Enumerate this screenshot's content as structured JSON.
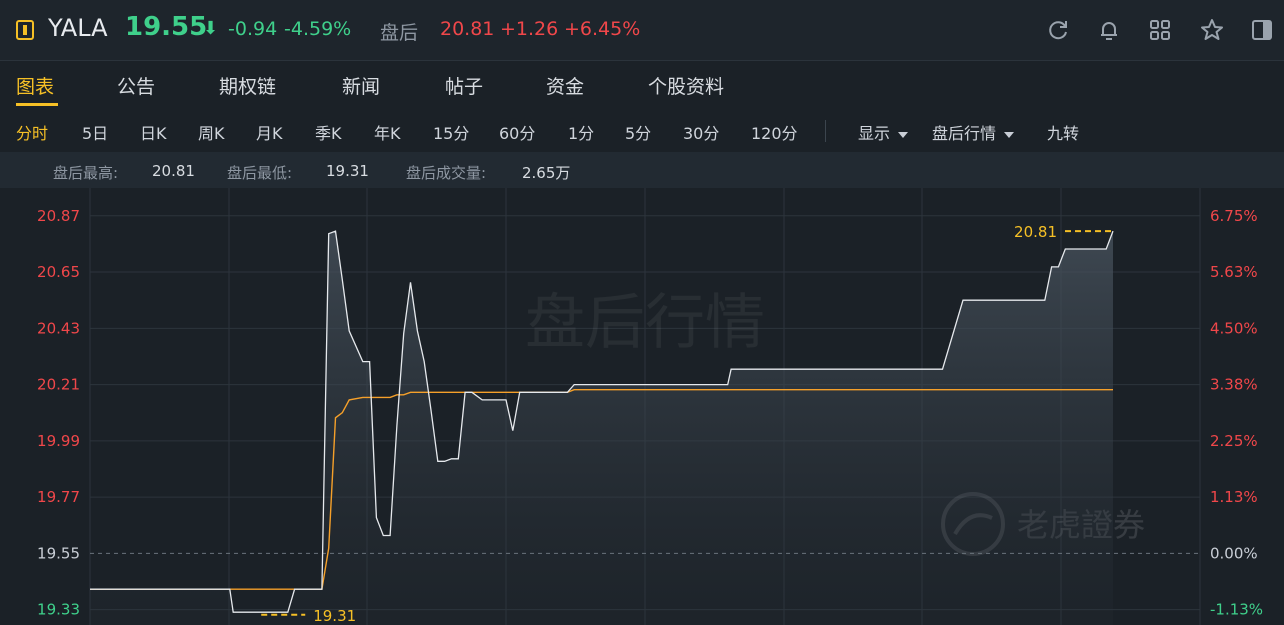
{
  "header": {
    "ticker": "YALA",
    "price": "19.55",
    "change": "-0.94",
    "change_pct": "-4.59%",
    "after_hours_label": "盘后",
    "after_hours_price": "20.81",
    "after_hours_change": "+1.26",
    "after_hours_change_pct": "+6.45%",
    "tool_icons": [
      "refresh-icon",
      "bell-icon",
      "grid-icon",
      "star-icon",
      "sidebar-toggle-icon"
    ]
  },
  "tabs": [
    "图表",
    "公告",
    "期权链",
    "新闻",
    "帖子",
    "资金",
    "个股资料"
  ],
  "periods": [
    "分时",
    "5日",
    "日K",
    "周K",
    "月K",
    "季K",
    "年K",
    "15分",
    "60分",
    "1分",
    "5分",
    "30分",
    "120分"
  ],
  "controls": {
    "display": "显示",
    "after_hours": "盘后行情",
    "nine_turn": "九转"
  },
  "stats": [
    {
      "label": "盘后最高:",
      "value": "20.81"
    },
    {
      "label": "盘后最低:",
      "value": "19.31"
    },
    {
      "label": "盘后成交量:",
      "value": "2.65万"
    }
  ],
  "watermark": {
    "text": "盘后行情",
    "brand": "老虎證券"
  },
  "colors": {
    "up": "#f0474a",
    "down": "#3fd08b",
    "accent": "#f6c026",
    "price_line": "#e6e9ed",
    "avg_line": "#f5a02a"
  },
  "chart_data": {
    "type": "line",
    "left_ticks": [
      "20.87",
      "20.65",
      "20.43",
      "20.21",
      "19.99",
      "19.77",
      "19.55",
      "19.33"
    ],
    "right_ticks": [
      "6.75%",
      "5.63%",
      "4.50%",
      "3.38%",
      "2.25%",
      "1.13%",
      "0.00%",
      "-1.13%"
    ],
    "ylim": [
      19.27,
      20.92
    ],
    "prev_close": 19.55,
    "high_label": "20.81",
    "low_label": "19.31",
    "high": 20.81,
    "low": 19.31,
    "x": [
      0,
      20,
      41,
      42,
      58,
      60,
      67,
      68,
      70,
      72,
      74,
      76,
      80,
      82,
      84,
      86,
      88,
      90,
      92,
      94,
      96,
      98,
      100,
      102,
      104,
      106,
      108,
      110,
      112,
      115,
      118,
      120,
      122,
      124,
      126,
      128,
      130,
      132,
      134,
      136,
      138,
      140,
      142,
      144,
      146,
      150,
      160,
      170,
      180,
      187,
      188,
      190,
      192,
      194,
      196,
      198,
      200,
      210,
      220,
      230,
      232,
      234,
      236,
      238,
      240,
      250,
      256,
      258,
      260,
      262,
      264,
      266,
      268,
      270,
      272,
      274,
      276,
      278,
      280,
      282,
      284,
      286,
      288,
      290,
      292,
      294,
      296,
      298,
      300
    ],
    "series": [
      {
        "values": [
          19.41,
          19.41,
          19.41,
          19.32,
          19.32,
          19.41,
          19.41,
          19.41,
          20.8,
          20.81,
          20.62,
          20.42,
          20.3,
          20.3,
          19.69,
          19.62,
          19.62,
          20.05,
          20.41,
          20.61,
          20.42,
          20.3,
          20.11,
          19.91,
          19.91,
          19.92,
          19.92,
          20.18,
          20.18,
          20.15,
          20.15,
          20.15,
          20.15,
          20.03,
          20.18,
          20.18,
          20.18,
          20.18,
          20.18,
          20.18,
          20.18,
          20.18,
          20.21,
          20.21,
          20.21,
          20.21,
          20.21,
          20.21,
          20.21,
          20.21,
          20.27,
          20.27,
          20.27,
          20.27,
          20.27,
          20.27,
          20.27,
          20.27,
          20.27,
          20.27,
          20.27,
          20.27,
          20.27,
          20.27,
          20.27,
          20.27,
          20.54,
          20.54,
          20.54,
          20.54,
          20.54,
          20.54,
          20.54,
          20.54,
          20.54,
          20.54,
          20.54,
          20.54,
          20.54,
          20.67,
          20.67,
          20.74,
          20.74,
          20.74,
          20.74,
          20.74,
          20.74,
          20.74,
          20.81
        ],
        "rebuilt": true
      },
      {
        "name": "",
        "values": [
          19.41,
          19.41,
          19.41,
          19.41,
          19.41,
          19.41,
          19.41,
          19.41,
          19.57,
          20.08,
          20.1,
          20.15,
          20.16,
          20.16,
          20.16,
          20.16,
          20.16,
          20.17,
          20.17,
          20.18,
          20.18,
          20.18,
          20.18,
          20.18,
          20.18,
          20.18,
          20.18,
          20.18,
          20.18,
          20.18,
          20.18,
          20.18,
          20.18,
          20.18,
          20.18,
          20.18,
          20.18,
          20.18,
          20.18,
          20.18,
          20.18,
          20.18,
          20.19,
          20.19,
          20.19,
          20.19,
          20.19,
          20.19,
          20.19,
          20.19,
          20.19,
          20.19,
          20.19,
          20.19,
          20.19,
          20.19,
          20.19,
          20.19,
          20.19,
          20.19,
          20.19,
          20.19,
          20.19,
          20.19,
          20.19,
          20.19,
          20.19,
          20.19,
          20.19,
          20.19,
          20.19,
          20.19,
          20.19,
          20.19,
          20.19,
          20.19,
          20.19,
          20.19,
          20.19,
          20.19,
          20.19,
          20.19,
          20.19,
          20.19,
          20.19,
          20.19,
          20.19,
          20.19,
          20.19
        ]
      }
    ]
  }
}
